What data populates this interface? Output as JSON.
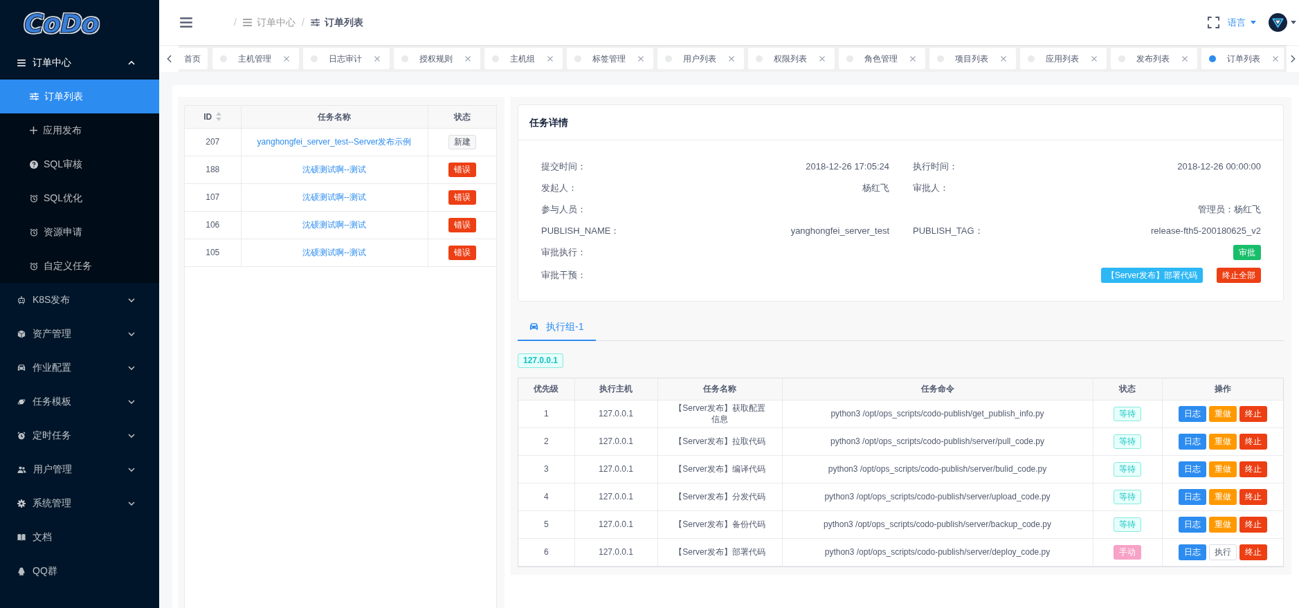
{
  "sidebar": {
    "logo": "CoDo",
    "items": [
      {
        "label": "订单中心",
        "kind": "submenu",
        "expanded": true,
        "children": [
          {
            "label": "订单列表",
            "selected": true
          },
          {
            "label": "应用发布",
            "selected": false
          },
          {
            "label": "SQL审核",
            "selected": false
          },
          {
            "label": "SQL优化",
            "selected": false
          },
          {
            "label": "资源申请",
            "selected": false
          },
          {
            "label": "自定义任务",
            "selected": false
          }
        ]
      },
      {
        "label": "K8S发布",
        "kind": "submenu",
        "expanded": false
      },
      {
        "label": "资产管理",
        "kind": "submenu",
        "expanded": false
      },
      {
        "label": "作业配置",
        "kind": "submenu",
        "expanded": false
      },
      {
        "label": "任务模板",
        "kind": "submenu",
        "expanded": false
      },
      {
        "label": "定时任务",
        "kind": "submenu",
        "expanded": false
      },
      {
        "label": "用户管理",
        "kind": "submenu",
        "expanded": false
      },
      {
        "label": "系统管理",
        "kind": "submenu",
        "expanded": false
      },
      {
        "label": "文档",
        "kind": "link",
        "selected": false
      },
      {
        "label": "QQ群",
        "kind": "link",
        "selected": false
      }
    ]
  },
  "header": {
    "breadcrumb": {
      "separator": "/",
      "items": [
        {
          "label": "订单中心",
          "selected": false
        },
        {
          "label": "订单列表",
          "selected": true
        }
      ]
    },
    "language": "语言"
  },
  "tabs": [
    {
      "label": "首页",
      "kind": "home",
      "selected": false,
      "closable": false
    },
    {
      "label": "主机管理",
      "kind": "page",
      "selected": false,
      "closable": true
    },
    {
      "label": "日志审计",
      "kind": "page",
      "selected": false,
      "closable": true
    },
    {
      "label": "授权规则",
      "kind": "page",
      "selected": false,
      "closable": true
    },
    {
      "label": "主机组",
      "kind": "page",
      "selected": false,
      "closable": true
    },
    {
      "label": "标签管理",
      "kind": "page",
      "selected": false,
      "closable": true
    },
    {
      "label": "用户列表",
      "kind": "page",
      "selected": false,
      "closable": true
    },
    {
      "label": "权限列表",
      "kind": "page",
      "selected": false,
      "closable": true
    },
    {
      "label": "角色管理",
      "kind": "page",
      "selected": false,
      "closable": true
    },
    {
      "label": "项目列表",
      "kind": "page",
      "selected": false,
      "closable": true
    },
    {
      "label": "应用列表",
      "kind": "page",
      "selected": false,
      "closable": true
    },
    {
      "label": "发布列表",
      "kind": "page",
      "selected": false,
      "closable": true
    },
    {
      "label": "订单列表",
      "kind": "page",
      "selected": true,
      "closable": true
    }
  ],
  "order_table": {
    "columns": [
      {
        "label": "ID",
        "sortable": true
      },
      {
        "label": "任务名称",
        "sortable": false
      },
      {
        "label": "状态",
        "sortable": false
      }
    ],
    "rows": [
      {
        "id": "207",
        "name": "yanghongfei_server_test--Server发布示例",
        "status": {
          "label": "新建",
          "kind": "new"
        }
      },
      {
        "id": "188",
        "name": "沈硕测试啊--测试",
        "status": {
          "label": "错误",
          "kind": "error"
        }
      },
      {
        "id": "107",
        "name": "沈硕测试啊--测试",
        "status": {
          "label": "错误",
          "kind": "error"
        }
      },
      {
        "id": "106",
        "name": "沈硕测试啊--测试",
        "status": {
          "label": "错误",
          "kind": "error"
        }
      },
      {
        "id": "105",
        "name": "沈硕测试啊--测试",
        "status": {
          "label": "错误",
          "kind": "error"
        }
      }
    ]
  },
  "task_detail": {
    "title": "任务详情",
    "fields": [
      {
        "label": "提交时间：",
        "value": "2018-12-26 17:05:24",
        "kind": "half"
      },
      {
        "label": "执行时间：",
        "value": "2018-12-26 00:00:00",
        "kind": "half"
      },
      {
        "label": "发起人：",
        "value": "杨红飞",
        "kind": "half"
      },
      {
        "label": "审批人：",
        "kind": "half"
      },
      {
        "label": "参与人员：",
        "value": "管理员：杨红飞",
        "kind": "full"
      },
      {
        "label": "PUBLISH_NAME：",
        "value": "yanghongfei_server_test",
        "kind": "half"
      },
      {
        "label": "PUBLISH_TAG：",
        "value": "release-fth5-200180625_v2",
        "kind": "half"
      }
    ],
    "actions": [
      {
        "label": "审批执行：",
        "buttons": [
          {
            "label": "审批",
            "kind": "success"
          }
        ]
      },
      {
        "label": "审批干预：",
        "buttons": [
          {
            "label": "【Server发布】部署代码",
            "kind": "info"
          },
          {
            "label": "终止全部",
            "kind": "danger"
          }
        ]
      }
    ]
  },
  "execution": {
    "groups": [
      {
        "label": "执行组-1",
        "selected": true
      }
    ],
    "hosts": [
      "127.0.0.1"
    ],
    "columns": [
      "优先级",
      "执行主机",
      "任务名称",
      "任务命令",
      "状态",
      "操作"
    ],
    "rows": [
      {
        "priority": "1",
        "host": "127.0.0.1",
        "name": "【Server发布】获取配置信息",
        "command": "python3 /opt/ops_scripts/codo-publish/get_publish_info.py",
        "status": {
          "label": "等待",
          "kind": "waiting"
        },
        "actions": [
          {
            "label": "日志",
            "kind": "primary"
          },
          {
            "label": "重做",
            "kind": "warning"
          },
          {
            "label": "终止",
            "kind": "danger"
          }
        ]
      },
      {
        "priority": "2",
        "host": "127.0.0.1",
        "name": "【Server发布】拉取代码",
        "command": "python3 /opt/ops_scripts/codo-publish/server/pull_code.py",
        "status": {
          "label": "等待",
          "kind": "waiting"
        },
        "actions": [
          {
            "label": "日志",
            "kind": "primary"
          },
          {
            "label": "重做",
            "kind": "warning"
          },
          {
            "label": "终止",
            "kind": "danger"
          }
        ]
      },
      {
        "priority": "3",
        "host": "127.0.0.1",
        "name": "【Server发布】编译代码",
        "command": "python3 /opt/ops_scripts/codo-publish/server/bulid_code.py",
        "status": {
          "label": "等待",
          "kind": "waiting"
        },
        "actions": [
          {
            "label": "日志",
            "kind": "primary"
          },
          {
            "label": "重做",
            "kind": "warning"
          },
          {
            "label": "终止",
            "kind": "danger"
          }
        ]
      },
      {
        "priority": "4",
        "host": "127.0.0.1",
        "name": "【Server发布】分发代码",
        "command": "python3 /opt/ops_scripts/codo-publish/server/upload_code.py",
        "status": {
          "label": "等待",
          "kind": "waiting"
        },
        "actions": [
          {
            "label": "日志",
            "kind": "primary"
          },
          {
            "label": "重做",
            "kind": "warning"
          },
          {
            "label": "终止",
            "kind": "danger"
          }
        ]
      },
      {
        "priority": "5",
        "host": "127.0.0.1",
        "name": "【Server发布】备份代码",
        "command": "python3 /opt/ops_scripts/codo-publish/server/backup_code.py",
        "status": {
          "label": "等待",
          "kind": "waiting"
        },
        "actions": [
          {
            "label": "日志",
            "kind": "primary"
          },
          {
            "label": "重做",
            "kind": "warning"
          },
          {
            "label": "终止",
            "kind": "danger"
          }
        ]
      },
      {
        "priority": "6",
        "host": "127.0.0.1",
        "name": "【Server发布】部署代码",
        "command": "python3 /opt/ops_scripts/codo-publish/server/deploy_code.py",
        "status": {
          "label": "手动",
          "kind": "manual"
        },
        "actions": [
          {
            "label": "日志",
            "kind": "primary"
          },
          {
            "label": "执行",
            "kind": "default"
          },
          {
            "label": "终止",
            "kind": "danger"
          }
        ]
      }
    ]
  }
}
